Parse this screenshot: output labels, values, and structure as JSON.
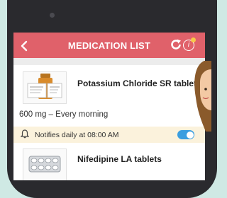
{
  "appbar": {
    "back_icon": "chevron-left-icon",
    "title": "MEDICATION LIST",
    "refresh_icon": "refresh-icon",
    "info_icon": "info-icon",
    "color": "#e0616a"
  },
  "medications": [
    {
      "name": "Potassium Chloride SR tablets",
      "dose": "600 mg – Every morning",
      "image": "pill-bottle-icon",
      "notification": {
        "text": "Notifies daily at 08:00 AM",
        "icon": "bell-icon",
        "enabled": true
      }
    },
    {
      "name": "Nifedipine LA tablets",
      "image": "blister-pack-icon"
    }
  ],
  "colors": {
    "accent": "#e0616a",
    "toggle_on": "#3a9ee0",
    "notify_bg": "#fbf2dc"
  }
}
